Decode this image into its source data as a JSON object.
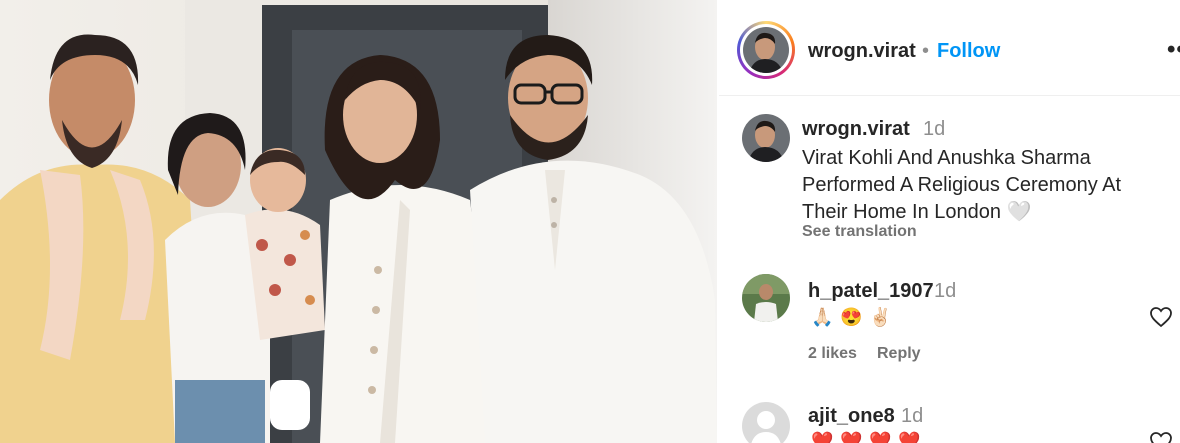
{
  "header": {
    "username": "wrogn.virat",
    "separator": "•",
    "follow_label": "Follow",
    "more_label": "••"
  },
  "caption": {
    "username": "wrogn.virat",
    "time": "1d",
    "text": "Virat Kohli And Anushka Sharma Performed A Religious Ceremony At Their Home In London",
    "emoji": "🤍",
    "see_translation": "See translation"
  },
  "comments": [
    {
      "username": "h_patel_1907",
      "time": "1d",
      "emojis": [
        "🙏🏻",
        "😍",
        "✌🏻"
      ],
      "likes": "2 likes",
      "reply": "Reply"
    },
    {
      "username": "ajit_one8",
      "time": "1d",
      "emojis": [
        "❤️",
        "❤️",
        "❤️",
        "❤️"
      ]
    }
  ],
  "colors": {
    "link": "#0095f6",
    "text": "#262626",
    "muted": "#737373"
  }
}
